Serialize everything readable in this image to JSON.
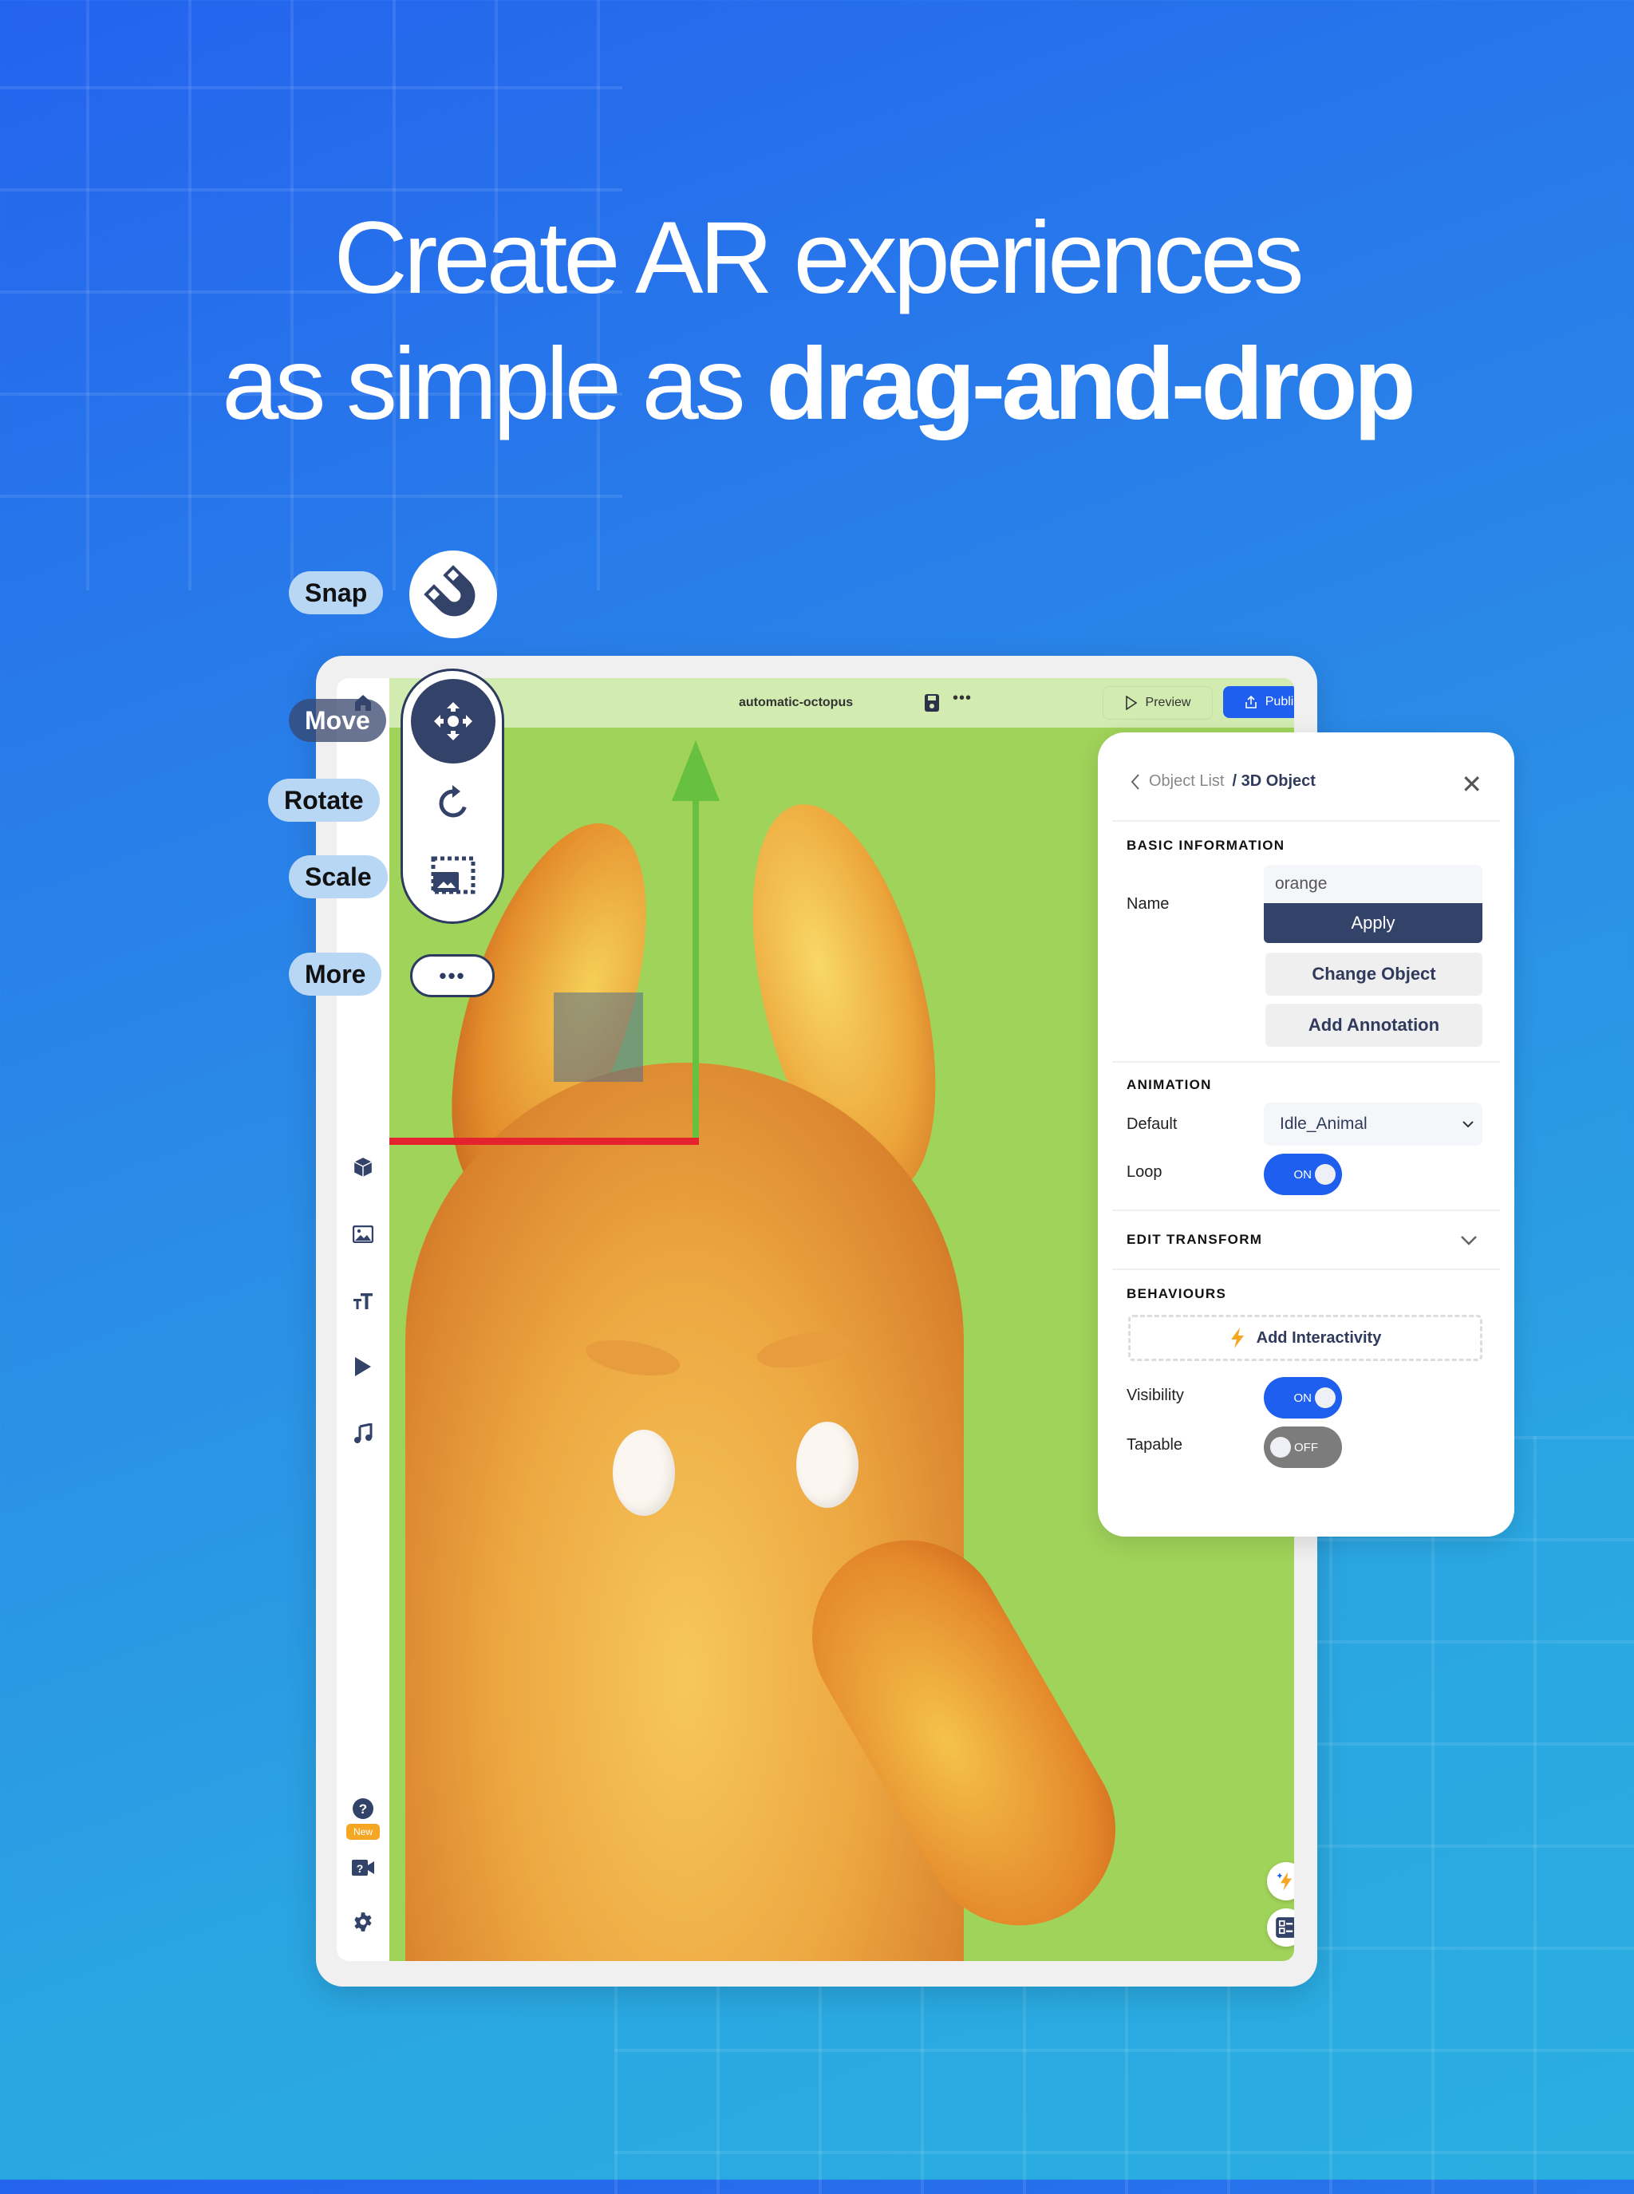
{
  "headline": {
    "line1": "Create AR experiences",
    "line2_regular": "as simple as ",
    "line2_bold": "drag-and-drop"
  },
  "toolbar": {
    "snap_label": "Snap",
    "move_label": "Move",
    "rotate_label": "Rotate",
    "scale_label": "Scale",
    "more_label": "More",
    "more_glyph": "•••",
    "active_tool": "Move"
  },
  "editor": {
    "project_name": "automatic-octopus",
    "more_glyph": "•••",
    "preview_label": "Preview",
    "publish_label": "Publish",
    "sidebar": {
      "items": [
        {
          "icon": "home-icon"
        },
        {
          "icon": "cube-icon"
        },
        {
          "icon": "image-icon"
        },
        {
          "icon": "text-icon"
        },
        {
          "icon": "video-play-icon"
        },
        {
          "icon": "music-icon"
        },
        {
          "icon": "help-icon",
          "badge": "New"
        },
        {
          "icon": "video-help-icon"
        },
        {
          "icon": "settings-icon"
        }
      ]
    }
  },
  "panel": {
    "breadcrumb_parent": "Object List",
    "breadcrumb_current": "/ 3D Object",
    "basic_info_title": "BASIC INFORMATION",
    "name_label": "Name",
    "name_value": "orange",
    "apply_label": "Apply",
    "change_object_label": "Change Object",
    "add_annotation_label": "Add Annotation",
    "animation_title": "ANIMATION",
    "default_label": "Default",
    "default_value": "Idle_Animal",
    "loop_label": "Loop",
    "loop_state": "ON",
    "edit_transform_title": "EDIT TRANSFORM",
    "behaviours_title": "BEHAVIOURS",
    "add_interactivity_label": "Add Interactivity",
    "visibility_label": "Visibility",
    "visibility_state": "ON",
    "tapable_label": "Tapable",
    "tapable_state": "OFF"
  },
  "colors": {
    "accent_blue": "#1f5ff0",
    "navy": "#334268",
    "canvas_green": "#a0d35a",
    "gizmo_y": "#67c040",
    "gizmo_x": "#e5232f",
    "lightning": "#f5a623"
  }
}
